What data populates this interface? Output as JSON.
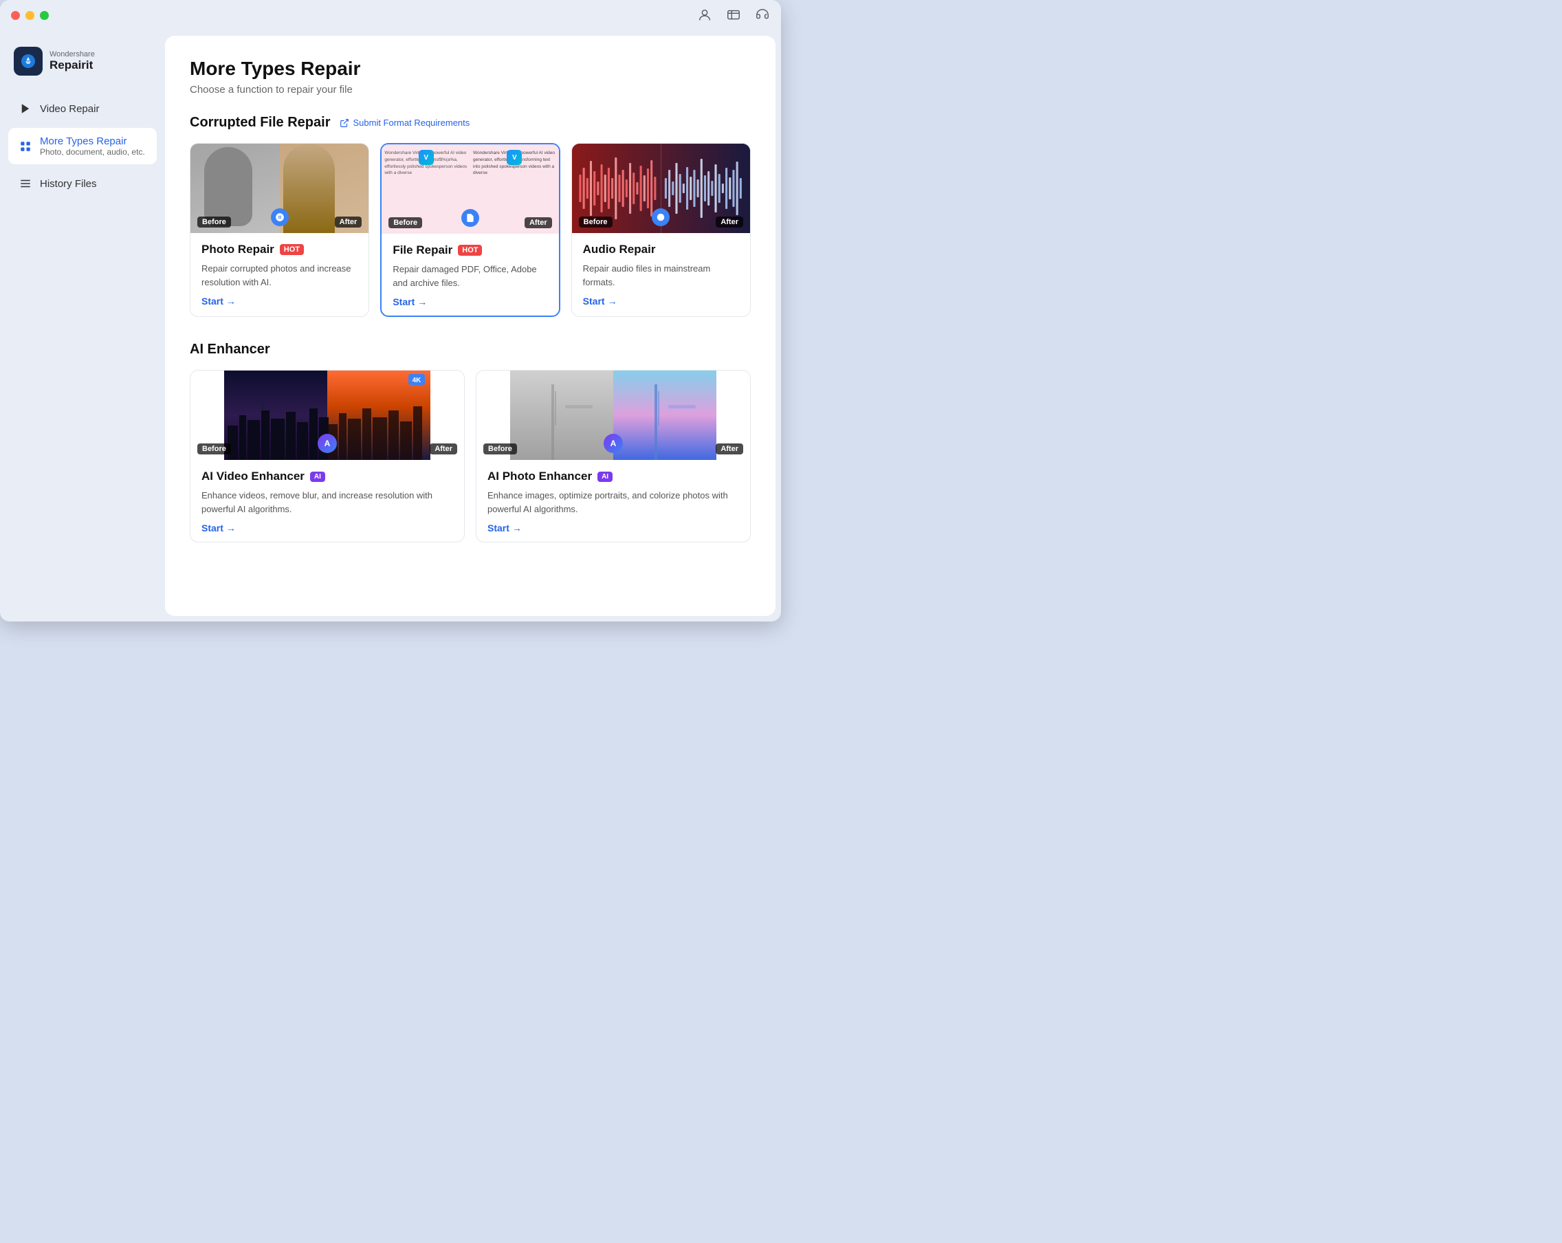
{
  "window": {
    "title": "Wondershare Repairit"
  },
  "logo": {
    "wondershare": "Wondershare",
    "repairit": "Repairit"
  },
  "sidebar": {
    "items": [
      {
        "id": "video-repair",
        "label": "Video Repair",
        "active": false
      },
      {
        "id": "more-types-repair",
        "label": "More Types Repair",
        "sub": "Photo, document, audio, etc.",
        "active": true
      },
      {
        "id": "history-files",
        "label": "History Files",
        "active": false
      }
    ]
  },
  "main": {
    "title": "More Types Repair",
    "subtitle": "Choose a function to repair your file",
    "sections": [
      {
        "id": "corrupted-file-repair",
        "title": "Corrupted File Repair",
        "submit_link": "Submit Format Requirements",
        "cards": [
          {
            "id": "photo-repair",
            "title": "Photo Repair",
            "badge": "HOT",
            "badge_type": "hot",
            "desc": "Repair corrupted photos and increase resolution with AI.",
            "start": "Start",
            "selected": false
          },
          {
            "id": "file-repair",
            "title": "File Repair",
            "badge": "HOT",
            "badge_type": "hot",
            "desc": "Repair damaged PDF, Office, Adobe and archive files.",
            "start": "Start",
            "selected": true
          },
          {
            "id": "audio-repair",
            "title": "Audio Repair",
            "badge": null,
            "desc": "Repair audio files in mainstream formats.",
            "start": "Start",
            "selected": false
          }
        ]
      },
      {
        "id": "ai-enhancer",
        "title": "AI Enhancer",
        "cards": [
          {
            "id": "ai-video-enhancer",
            "title": "AI Video Enhancer",
            "badge": "AI",
            "badge_type": "ai",
            "desc": "Enhance videos, remove blur, and increase resolution with powerful AI algorithms.",
            "start": "Start",
            "selected": false
          },
          {
            "id": "ai-photo-enhancer",
            "title": "AI Photo Enhancer",
            "badge": "AI",
            "badge_type": "ai",
            "desc": "Enhance images, optimize portraits, and colorize photos with powerful AI algorithms.",
            "start": "Start",
            "selected": false
          }
        ]
      }
    ]
  }
}
